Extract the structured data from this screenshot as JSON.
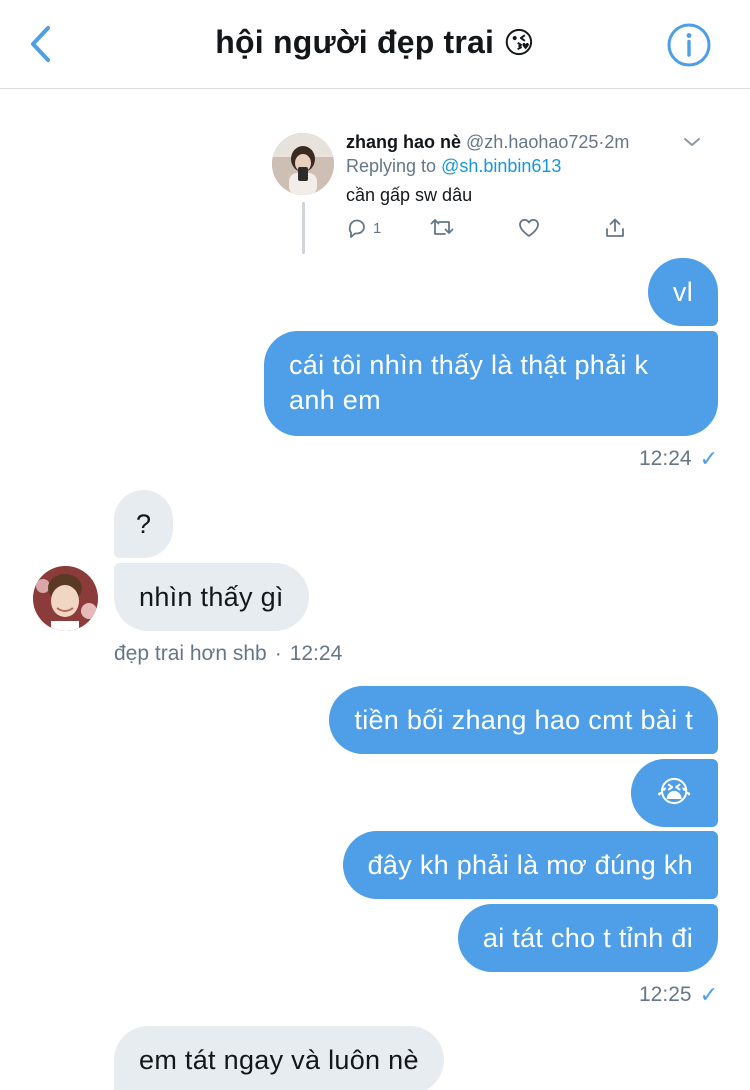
{
  "header": {
    "title": "hội người đẹp trai",
    "title_emoji": "😘"
  },
  "quoted_tweet": {
    "name": "zhang hao nè",
    "handle": "@zh.haohao725",
    "separator": "·",
    "time": "2m",
    "replying_prefix": "Replying to",
    "replying_handle": "@sh.binbin613",
    "text": "cần gấp sw dâu",
    "reply_count": "1"
  },
  "messages": [
    {
      "id": "m1",
      "side": "sent",
      "text": "vl"
    },
    {
      "id": "m2",
      "side": "sent",
      "text": "cái tôi nhìn thấy là thật phải k anh em"
    },
    {
      "id": "m3",
      "side": "recv",
      "text": "?"
    },
    {
      "id": "m4",
      "side": "recv",
      "text": "nhìn thấy gì"
    },
    {
      "id": "m5",
      "side": "sent",
      "text": "tiền bối zhang hao cmt bài t"
    },
    {
      "id": "m6",
      "side": "sent",
      "text": "😭"
    },
    {
      "id": "m7",
      "side": "sent",
      "text": "đây kh phải là mơ đúng kh"
    },
    {
      "id": "m8",
      "side": "sent",
      "text": "ai tát cho t tỉnh đi"
    },
    {
      "id": "m9",
      "side": "recv",
      "text": "em tát ngay và luôn nè"
    }
  ],
  "timestamps": {
    "sent_group_1": "12:24",
    "recv_group_1_sender": "đẹp trai hơn shb",
    "recv_group_1_separator": "·",
    "recv_group_1_time": "12:24",
    "sent_group_2": "12:25",
    "read_mark": "✓"
  },
  "colors": {
    "accent": "#4e9ee8",
    "link": "#1b95e0",
    "recv_bubble": "#e6ecf0",
    "muted": "#657786"
  }
}
